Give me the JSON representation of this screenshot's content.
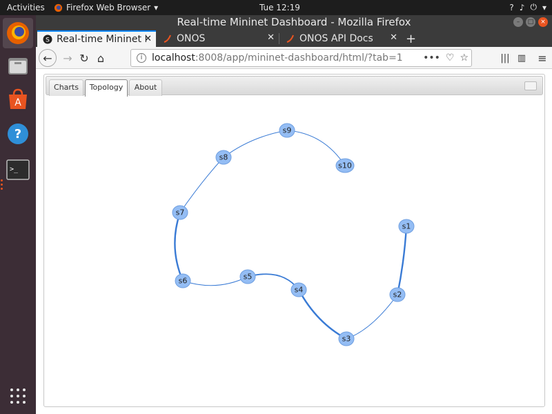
{
  "topbar": {
    "activities": "Activities",
    "app_menu": "Firefox Web Browser",
    "clock": "Tue 12:19"
  },
  "dock": {
    "items": [
      "firefox-icon",
      "files-icon",
      "software-icon",
      "help-icon",
      "terminal-icon"
    ],
    "apps_grid": "show-applications-icon"
  },
  "window": {
    "title": "Real-time Mininet Dashboard - Mozilla Firefox"
  },
  "browser": {
    "tabs": [
      {
        "label": "Real-time Mininet Da",
        "active": true
      },
      {
        "label": "ONOS",
        "active": false
      },
      {
        "label": "ONOS API Docs",
        "active": false
      }
    ],
    "url": {
      "host": "localhost",
      "path": ":8008/app/mininet-dashboard/html/?tab=1"
    }
  },
  "page": {
    "tabs": [
      "Charts",
      "Topology",
      "About"
    ],
    "active_tab": "Topology"
  },
  "topology": {
    "node_color": "#94bdf4",
    "link_color": "#3a7bd5",
    "nodes": [
      {
        "id": "s1",
        "label": "s1"
      },
      {
        "id": "s2",
        "label": "s2"
      },
      {
        "id": "s3",
        "label": "s3"
      },
      {
        "id": "s4",
        "label": "s4"
      },
      {
        "id": "s5",
        "label": "s5"
      },
      {
        "id": "s6",
        "label": "s6"
      },
      {
        "id": "s7",
        "label": "s7"
      },
      {
        "id": "s8",
        "label": "s8"
      },
      {
        "id": "s9",
        "label": "s9"
      },
      {
        "id": "s10",
        "label": "s10"
      }
    ],
    "links": [
      {
        "source": "s1",
        "target": "s2",
        "weight": "thick"
      },
      {
        "source": "s2",
        "target": "s3",
        "weight": "thin"
      },
      {
        "source": "s3",
        "target": "s4",
        "weight": "thick"
      },
      {
        "source": "s4",
        "target": "s5",
        "weight": "medium"
      },
      {
        "source": "s5",
        "target": "s6",
        "weight": "thin"
      },
      {
        "source": "s6",
        "target": "s7",
        "weight": "thick"
      },
      {
        "source": "s7",
        "target": "s8",
        "weight": "thin"
      },
      {
        "source": "s8",
        "target": "s9",
        "weight": "thin"
      },
      {
        "source": "s9",
        "target": "s10",
        "weight": "thin"
      }
    ]
  }
}
